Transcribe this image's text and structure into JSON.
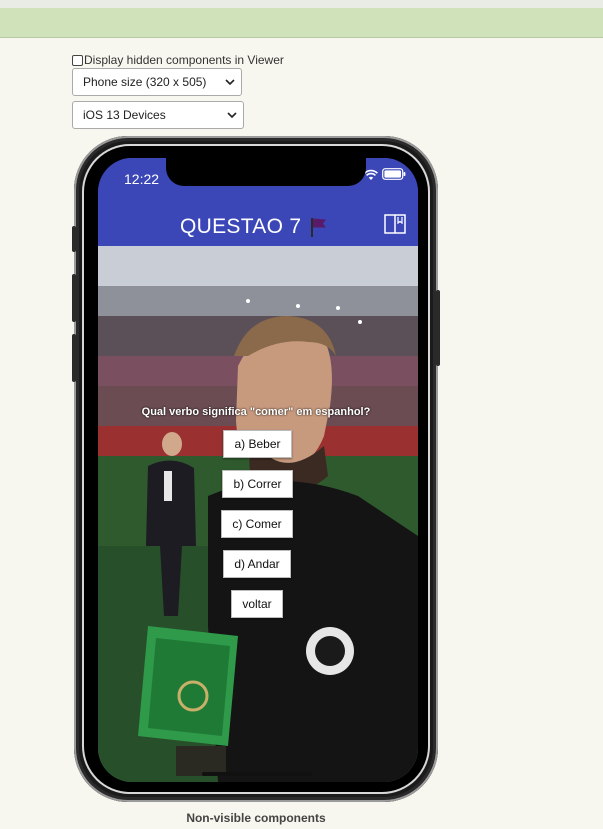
{
  "viewer_options": {
    "hidden_components_label": "Display hidden components in Viewer",
    "size_select_value": "Phone size (320 x 505)",
    "device_select_value": "iOS 13 Devices"
  },
  "phone": {
    "status_time": "12:22",
    "title": "QUESTAO 7",
    "question": "Qual verbo significa \"comer\" em espanhol?",
    "answers": [
      "a) Beber",
      "b) Correr",
      "c) Comer",
      "d) Andar"
    ],
    "back_label": "voltar"
  },
  "footer": {
    "non_visible_label": "Non-visible components"
  }
}
